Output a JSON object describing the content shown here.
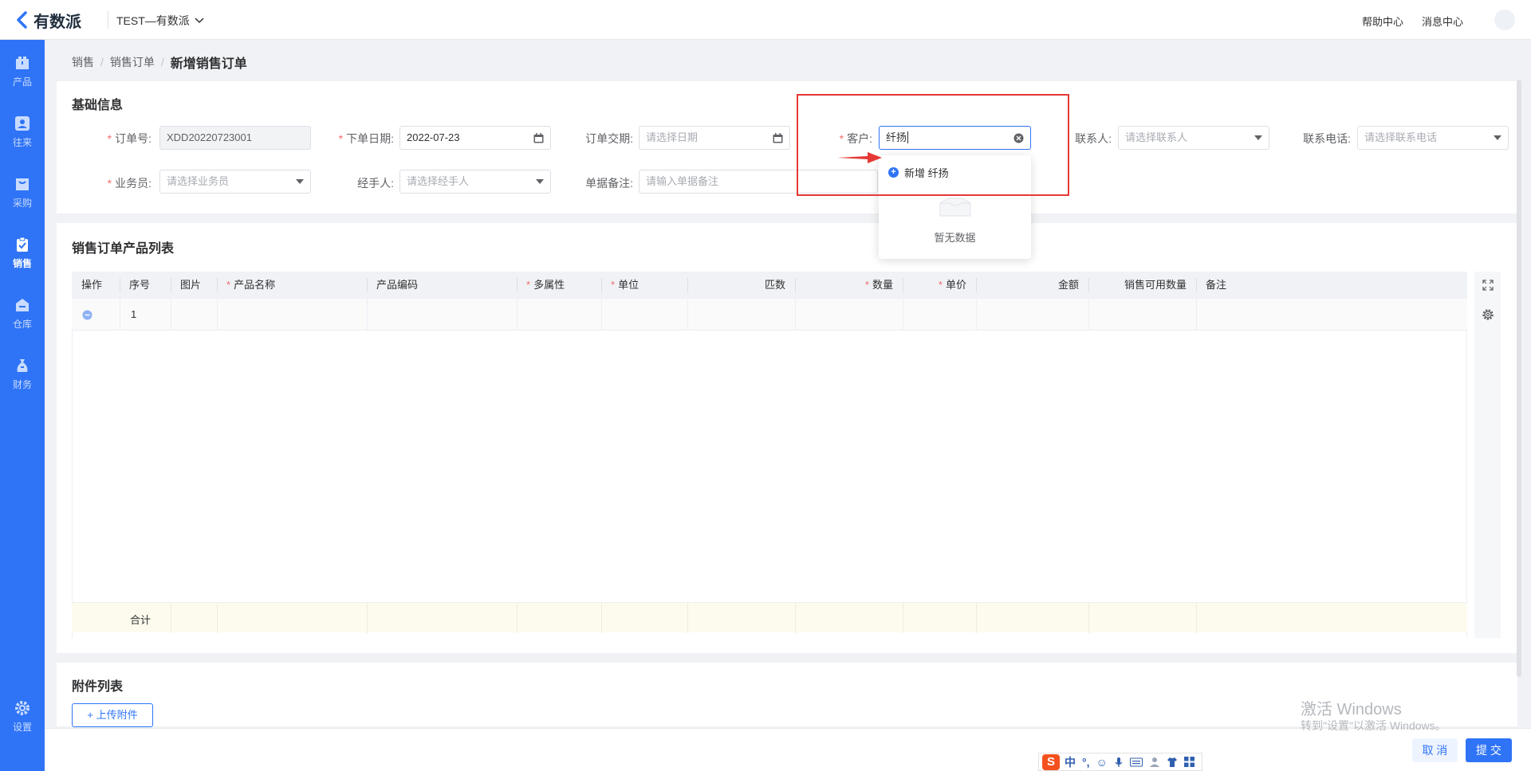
{
  "header": {
    "logo_text": "有数派",
    "org_name": "TEST—有数派",
    "help_link": "帮助中心",
    "message_link": "消息中心"
  },
  "sidebar": {
    "items": [
      {
        "label": "产品",
        "icon": "box-icon"
      },
      {
        "label": "往来",
        "icon": "contact-icon"
      },
      {
        "label": "采购",
        "icon": "store-icon"
      },
      {
        "label": "销售",
        "icon": "clipboard-check-icon",
        "active": true
      },
      {
        "label": "仓库",
        "icon": "warehouse-icon"
      },
      {
        "label": "财务",
        "icon": "money-bag-icon"
      }
    ],
    "settings_label": "设置"
  },
  "breadcrumb": {
    "items": [
      "销售",
      "销售订单"
    ],
    "current": "新增销售订单"
  },
  "basic_info": {
    "title": "基础信息",
    "order_no": {
      "label": "订单号:",
      "value": "XDD20220723001"
    },
    "order_date": {
      "label": "下单日期:",
      "value": "2022-07-23"
    },
    "delivery_date": {
      "label": "订单交期:",
      "placeholder": "请选择日期"
    },
    "customer": {
      "label": "客户:",
      "value": "纤扬"
    },
    "contact": {
      "label": "联系人:",
      "placeholder": "请选择联系人"
    },
    "phone": {
      "label": "联系电话:",
      "placeholder": "请选择联系电话"
    },
    "salesman": {
      "label": "业务员:",
      "placeholder": "请选择业务员"
    },
    "handler": {
      "label": "经手人:",
      "placeholder": "请选择经手人"
    },
    "remark": {
      "label": "单据备注:",
      "placeholder": "请输入单据备注"
    }
  },
  "customer_dropdown": {
    "add_option": "新增 纤扬",
    "empty_text": "暂无数据"
  },
  "product_table": {
    "title": "销售订单产品列表",
    "columns": [
      "操作",
      "序号",
      "图片",
      "产品名称",
      "产品编码",
      "多属性",
      "单位",
      "匹数",
      "数量",
      "单价",
      "金额",
      "销售可用数量",
      "备注"
    ],
    "rows": [
      {
        "index": "1"
      }
    ],
    "sum_label": "合计"
  },
  "attachments": {
    "title": "附件列表",
    "upload_label": "+ 上传附件"
  },
  "footer": {
    "cancel_label": "取 消",
    "submit_label": "提 交"
  },
  "watermark": {
    "line1": "激活 Windows",
    "line2": "转到\"设置\"以激活 Windows。"
  },
  "ime": {
    "logo": "S",
    "mode": "中",
    "punct": "°,"
  },
  "colors": {
    "primary": "#2f74f6",
    "required": "#f56c6c",
    "annotation": "#e53935"
  }
}
